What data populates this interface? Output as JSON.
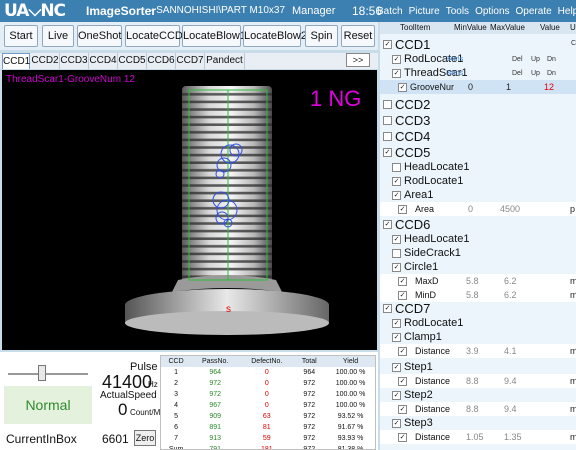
{
  "titlebar": {
    "logo": "UA⌵NC",
    "app": "ImageSorter",
    "sep": " - ",
    "path": "SANNOHISHI\\PART M10x37",
    "user": "Manager",
    "clock": "18:56"
  },
  "menu": [
    "Batch",
    "Picture",
    "Tools",
    "Options",
    "Operate",
    "Help"
  ],
  "menu_min": "–",
  "toolbar": {
    "start": "Start",
    "live": "Live",
    "oneshot": "OneShot",
    "locate_ccd": "LocateCCD",
    "locate_blow1": "LocateBlow1",
    "locate_blow2": "LocateBlow2",
    "spin": "Spin",
    "reset": "Reset"
  },
  "tabs": [
    "CCD1",
    "CCD2",
    "CCD3",
    "CCD4",
    "CCD5",
    "CCD6",
    "CCD7",
    "Pandect"
  ],
  "tab_more": ">>",
  "camera": {
    "overlay_text": "ThreadScar1-GrooveNum  12",
    "result": "1 NG",
    "marker": "s"
  },
  "status": {
    "pulse_label": "Pulse",
    "pulse_value": "41400",
    "pulse_unit": "Hz",
    "speed_label": "ActualSpeed",
    "speed_value": "0",
    "speed_unit": "Count/M",
    "state": "Normal",
    "inbox_label": "CurrentInBox",
    "inbox_value": "6601",
    "zero_label": "Zero",
    "slider_level": 0.42
  },
  "stats": {
    "headers": [
      "CCD",
      "PassNo.",
      "DefectNo.",
      "Total",
      "Yield"
    ],
    "rows": [
      [
        "1",
        "964",
        "0",
        "964",
        "100.00 %"
      ],
      [
        "2",
        "972",
        "0",
        "972",
        "100.00 %"
      ],
      [
        "3",
        "972",
        "0",
        "972",
        "100.00 %"
      ],
      [
        "4",
        "967",
        "0",
        "972",
        "100.00 %"
      ],
      [
        "5",
        "909",
        "63",
        "972",
        "93.52 %"
      ],
      [
        "6",
        "891",
        "81",
        "972",
        "91.67 %"
      ],
      [
        "7",
        "913",
        "59",
        "972",
        "93.93 %"
      ],
      [
        "Sum",
        "791",
        "181",
        "972",
        "81.38 %"
      ]
    ]
  },
  "tree": {
    "headers": [
      "ToolItem",
      "MinValue",
      "MaxValue",
      "Value",
      "U"
    ],
    "ccd1": "CCD1",
    "ccd1_extra": "C",
    "rodlocate1": "RodLocate1",
    "rod_ms": "34ms",
    "threadscar1": "ThreadScar1",
    "thread_ms": "34ms",
    "del": "Del",
    "up": "Up",
    "dn": "Dn",
    "groovenum": "GrooveNur",
    "groove_min": "0",
    "groove_max": "1",
    "groove_val": "12",
    "ccd2": "CCD2",
    "ccd3": "CCD3",
    "ccd4": "CCD4",
    "ccd5": "CCD5",
    "headlocate1_5": "HeadLocate1",
    "rodlocate1_5": "RodLocate1",
    "area1": "Area1",
    "area": "Area",
    "area_min": "0",
    "area_max": "4500",
    "area_u": "p",
    "ccd6": "CCD6",
    "headlocate1_6": "HeadLocate1",
    "sidecrack1": "SideCrack1",
    "circle1": "Circle1",
    "maxd": "MaxD",
    "maxd_min": "5.8",
    "maxd_max": "6.2",
    "mind": "MinD",
    "mind_min": "5.8",
    "mind_max": "6.2",
    "m": "m",
    "ccd7": "CCD7",
    "rodlocate1_7": "RodLocate1",
    "clamp1": "Clamp1",
    "distance": "Distance",
    "clamp_min": "3.9",
    "clamp_max": "4.1",
    "step1": "Step1",
    "step1_min": "8.8",
    "step1_max": "9.4",
    "step2": "Step2",
    "step2_min": "8.8",
    "step2_max": "9.4",
    "step3": "Step3",
    "step3_min": "1.05",
    "step3_max": "1.35",
    "check": "✓"
  },
  "colors": {
    "titlebar": "#3c7fb1",
    "ng": "#e000e0",
    "normal_bg": "#e4f1dc",
    "normal_text": "#2f8a2f",
    "defect": "#e00000",
    "pass": "#2a8a2a"
  }
}
